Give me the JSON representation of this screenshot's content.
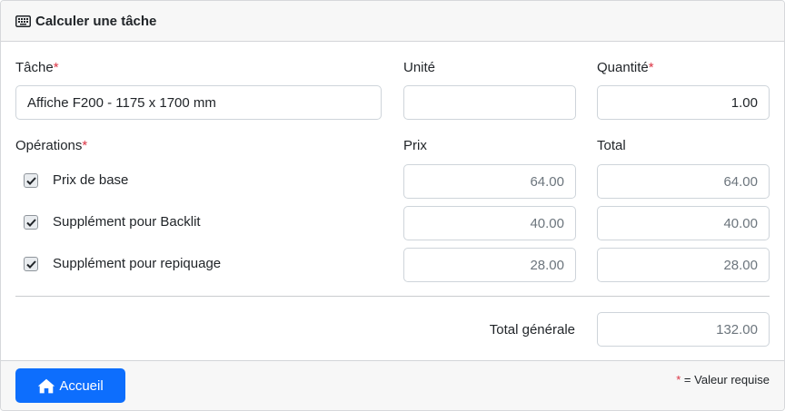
{
  "header": {
    "title": "Calculer une tâche",
    "icon": "keyboard-icon"
  },
  "form": {
    "task": {
      "label": "Tâche",
      "required_mark": "*",
      "value": "Affiche F200 - 1175 x 1700 mm"
    },
    "unit": {
      "label": "Unité",
      "value": ""
    },
    "quantity": {
      "label": "Quantité",
      "required_mark": "*",
      "value": "1.00"
    },
    "operations_label": "Opérations",
    "operations_required_mark": "*",
    "price_label": "Prix",
    "total_label": "Total",
    "operations": [
      {
        "label": "Prix de base",
        "checked": true,
        "price": "64.00",
        "total": "64.00"
      },
      {
        "label": "Supplément pour Backlit",
        "checked": true,
        "price": "40.00",
        "total": "40.00"
      },
      {
        "label": "Supplément pour repiquage",
        "checked": true,
        "price": "28.00",
        "total": "28.00"
      }
    ],
    "grand_total": {
      "label": "Total générale",
      "value": "132.00"
    }
  },
  "footer": {
    "home_button_label": "Accueil",
    "home_icon": "home-icon",
    "required_legend_mark": "*",
    "required_legend_text": " = Valeur requise"
  },
  "colors": {
    "primary": "#0d6efd",
    "required": "#dc3545",
    "readonly_text": "#6c757d"
  }
}
